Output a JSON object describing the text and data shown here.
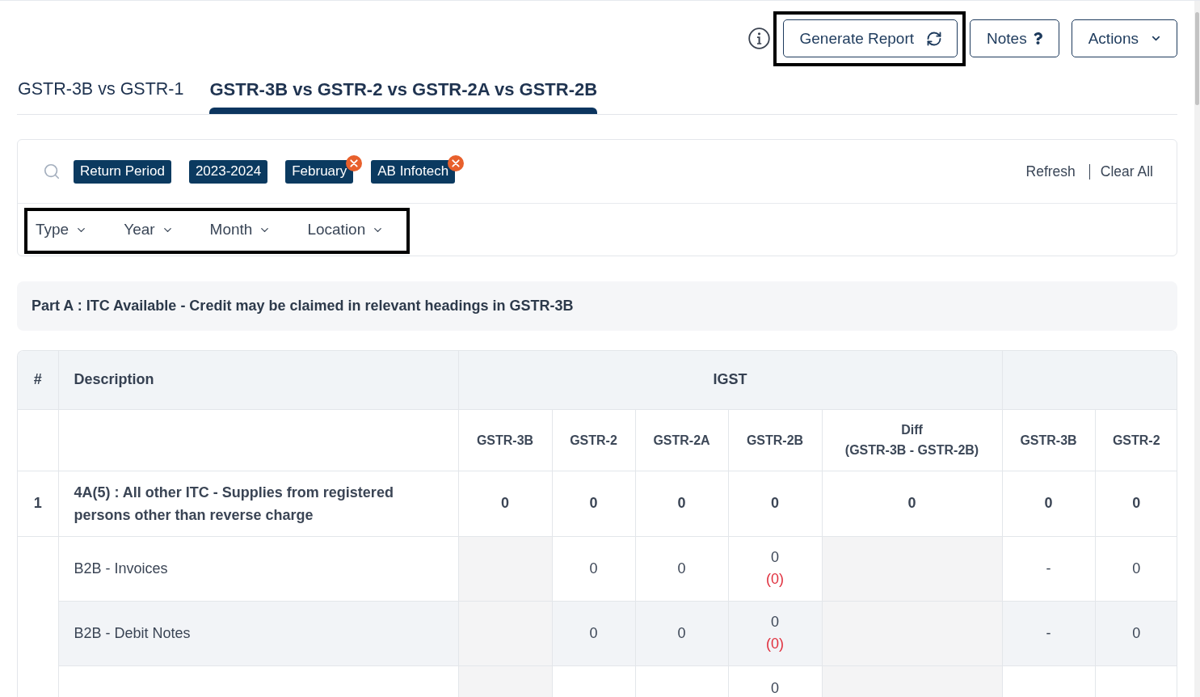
{
  "toolbar": {
    "buttons": [
      {
        "label": "Generate Report",
        "kind": "refresh",
        "highlighted": true
      },
      {
        "label": "Notes",
        "kind": "question",
        "highlighted": false
      },
      {
        "label": "Actions",
        "kind": "dropdown",
        "highlighted": false
      }
    ]
  },
  "tabs": [
    {
      "label": "GSTR-3B vs GSTR-1",
      "selected": false
    },
    {
      "label": "GSTR-3B vs GSTR-2 vs GSTR-2A vs GSTR-2B",
      "selected": true
    }
  ],
  "filters": {
    "chips": [
      {
        "label": "Return Period",
        "removable": false
      },
      {
        "label": "2023-2024",
        "removable": false
      },
      {
        "label": "February",
        "removable": true
      },
      {
        "label": "AB Infotech",
        "removable": true
      }
    ],
    "actions": [
      "Refresh",
      "Clear All"
    ],
    "dropdown_bar": {
      "highlighted": true,
      "items": [
        "Type",
        "Year",
        "Month",
        "Location"
      ]
    }
  },
  "section": {
    "title": "Part A : ITC Available - Credit may be claimed in relevant headings in GSTR-3B"
  },
  "table": {
    "header_groups": [
      {
        "kind": "index",
        "label": "#"
      },
      {
        "kind": "label",
        "label": "Description"
      },
      {
        "kind": "group",
        "label": "IGST",
        "columns": [
          "GSTR-3B",
          "GSTR-2",
          "GSTR-2A",
          "GSTR-2B",
          "Diff\n(GSTR-3B - GSTR-2B)"
        ]
      },
      {
        "kind": "group",
        "columns": [
          "GSTR-3B",
          "GSTR-2"
        ]
      }
    ],
    "rows": [
      {
        "kind": "total",
        "number": "1",
        "description": "4A(5) : All other ITC - Supplies from registered persons other than reverse charge",
        "hovered": false,
        "cells": [
          {
            "kind": "value",
            "value": "0"
          },
          {
            "kind": "value",
            "value": "0"
          },
          {
            "kind": "value",
            "value": "0"
          },
          {
            "kind": "value",
            "value": "0"
          },
          {
            "kind": "value",
            "value": "0"
          },
          {
            "kind": "value",
            "value": "0"
          },
          {
            "kind": "value",
            "value": "0"
          }
        ]
      },
      {
        "kind": "detail",
        "description": "B2B - Invoices",
        "hovered": false,
        "cells": [
          {
            "kind": "empty"
          },
          {
            "kind": "value",
            "value": "0"
          },
          {
            "kind": "value",
            "value": "0"
          },
          {
            "kind": "value",
            "value": "0",
            "variance": "(0)"
          },
          {
            "kind": "empty"
          },
          {
            "kind": "value",
            "value": "-"
          },
          {
            "kind": "value",
            "value": "0"
          }
        ]
      },
      {
        "kind": "detail",
        "description": "B2B - Debit Notes",
        "hovered": true,
        "cells": [
          {
            "kind": "empty"
          },
          {
            "kind": "value",
            "value": "0"
          },
          {
            "kind": "value",
            "value": "0"
          },
          {
            "kind": "value",
            "value": "0",
            "variance": "(0)"
          },
          {
            "kind": "empty"
          },
          {
            "kind": "value",
            "value": "-"
          },
          {
            "kind": "value",
            "value": "0"
          }
        ]
      },
      {
        "kind": "detail",
        "hovered": false,
        "cells": [
          {
            "kind": "empty"
          },
          {
            "kind": "value"
          },
          {
            "kind": "value"
          },
          {
            "kind": "value",
            "value": "0"
          },
          {
            "kind": "empty"
          },
          {
            "kind": "value"
          },
          {
            "kind": "value"
          }
        ]
      }
    ]
  }
}
